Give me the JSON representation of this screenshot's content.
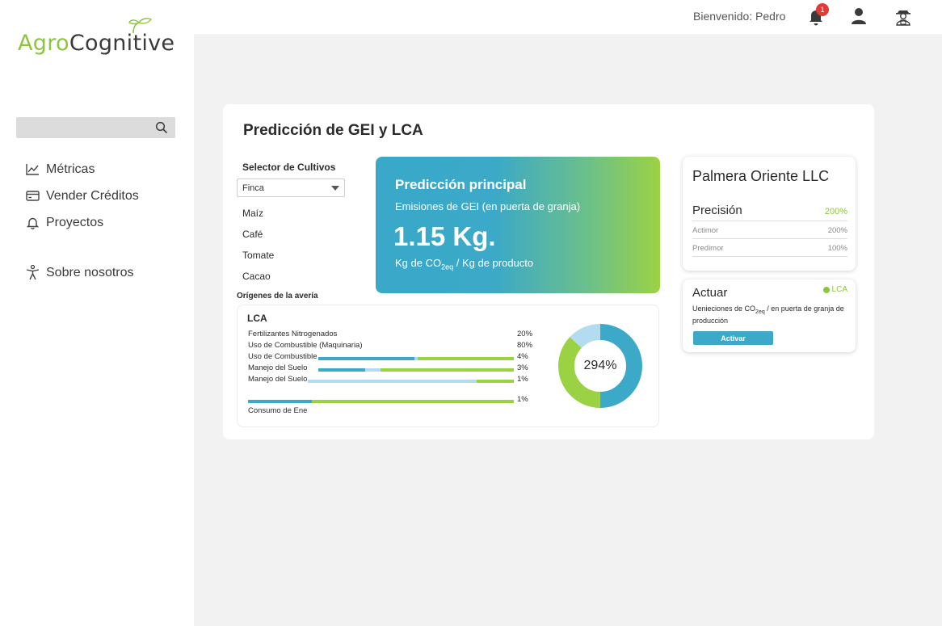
{
  "brand": {
    "name_part1": "Agro",
    "name_part2": "Cognitive"
  },
  "colors": {
    "brand_green": "#8cc63f",
    "accent_blue": "#3ba9c7",
    "bar_light": "#b3dcf0",
    "badge_red": "#e53935"
  },
  "sidebar": {
    "search": {
      "placeholder": "",
      "icon": "search-icon"
    },
    "items": [
      {
        "label": "Métricas",
        "icon": "chart-line-icon"
      },
      {
        "label": "Vender Créditos",
        "icon": "credit-card-icon"
      },
      {
        "label": "Proyectos",
        "icon": "bell-outline-icon"
      },
      {
        "label": "Sobre nosotros",
        "icon": "accessibility-icon"
      }
    ]
  },
  "header": {
    "welcome": "Bienvenido: Pedro",
    "notifications_count": "1"
  },
  "main": {
    "title": "Predicción de GEI y LCA",
    "selector": {
      "label": "Selector de Cultivos",
      "value": "Finca",
      "crops": [
        "Maíz",
        "Café",
        "Tomate",
        "Cacao"
      ]
    },
    "prediction": {
      "heading": "Predicción principal",
      "subtitle": "Emisiones de GEI (en puerta de granja)",
      "value": "1.15 Kg.",
      "unit_prefix": "Kg de CO",
      "unit_sub": "2eq",
      "unit_suffix": " / Kg de producto"
    },
    "origins_label": "Orígenes de la avería",
    "lca": {
      "title": "LCA",
      "rows": [
        {
          "name": "Fertilizantes Nitrogenados",
          "pct": "20%",
          "blue": 0,
          "light": 0,
          "green": 0
        },
        {
          "name": "Uso de Combustible (Maquinaria)",
          "pct": "80%",
          "blue": 0,
          "light": 0,
          "green": 0
        },
        {
          "name": "Uso de Combustible",
          "pct": "4%",
          "blue": 0.49,
          "light": 0.02,
          "green": 0.49
        },
        {
          "name": "Manejo del Suelo",
          "pct": "3%",
          "blue": 0.24,
          "light": 0.08,
          "green": 0.68
        },
        {
          "name": "Manejo del Suelo",
          "pct": "1%",
          "blue": 0,
          "light": 0.82,
          "green": 0.18
        },
        {
          "name": "",
          "pct": "1%",
          "blue": 0.24,
          "light": 0,
          "green": 0.76
        }
      ],
      "extra_label": "Consumo de Ene",
      "donut": {
        "label": "294%",
        "segments": [
          {
            "value": 0.5,
            "color": "#3ba9c7"
          },
          {
            "value": 0.37,
            "color": "#9bd243"
          },
          {
            "value": 0.13,
            "color": "#b3dcf0"
          }
        ]
      }
    },
    "company": {
      "name": "Palmera Oriente LLC",
      "precision_label": "Precisión",
      "precision_value": "200%",
      "rows": [
        {
          "label": "Actimor",
          "value": "200%"
        },
        {
          "label": "Predimor",
          "value": "100%"
        }
      ]
    },
    "actuar": {
      "title": "Actuar",
      "tag": "LCA",
      "desc_prefix": "Uenieciones de CO",
      "desc_sub": "2eq",
      "desc_suffix": " / en puerta de granja de producción",
      "button": "Activar"
    }
  }
}
